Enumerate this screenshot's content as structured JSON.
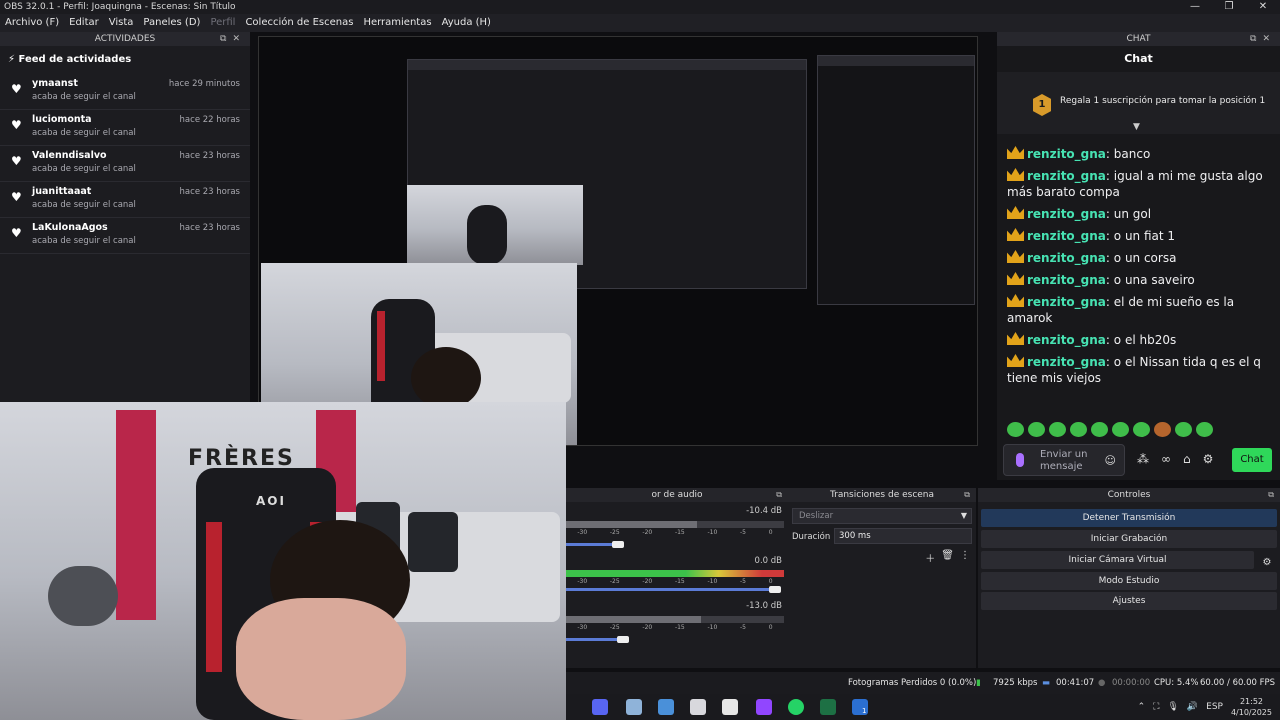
{
  "window": {
    "title": "OBS 32.0.1 - Perfil: Joaquingna - Escenas: Sin Título",
    "controls": [
      "—",
      "❐",
      "✕"
    ]
  },
  "menu": [
    {
      "label": "Archivo (F)",
      "enabled": true
    },
    {
      "label": "Editar",
      "enabled": true
    },
    {
      "label": "Vista",
      "enabled": true
    },
    {
      "label": "Paneles (D)",
      "enabled": true
    },
    {
      "label": "Perfil",
      "enabled": false
    },
    {
      "label": "Colección de Escenas",
      "enabled": true
    },
    {
      "label": "Herramientas",
      "enabled": true
    },
    {
      "label": "Ayuda (H)",
      "enabled": true
    }
  ],
  "activities": {
    "dock_title": "ACTIVIDADES",
    "feed_title": "Feed de actividades",
    "items": [
      {
        "name": "ymaanst",
        "time": "hace 29 minutos",
        "action": "acaba de seguir el canal"
      },
      {
        "name": "luciomonta",
        "time": "hace 22 horas",
        "action": "acaba de seguir el canal"
      },
      {
        "name": "Valenndisalvo",
        "time": "hace 23 horas",
        "action": "acaba de seguir el canal"
      },
      {
        "name": "juanittaaat",
        "time": "hace 23 horas",
        "action": "acaba de seguir el canal"
      },
      {
        "name": "LaKulonaAgos",
        "time": "hace 23 horas",
        "action": "acaba de seguir el canal"
      }
    ]
  },
  "preview": {
    "banner_text": "FRÈRES",
    "chair_text": "AOI"
  },
  "chat": {
    "dock_title": "CHAT",
    "title": "Chat",
    "gift_rank": "1",
    "gift_text": "Regala 1 suscripción para tomar la posición 1",
    "messages": [
      {
        "user": "renzito_gna",
        "text": "banco"
      },
      {
        "user": "renzito_gna",
        "text": "igual a mi me gusta algo más barato compa"
      },
      {
        "user": "renzito_gna",
        "text": "un gol"
      },
      {
        "user": "renzito_gna",
        "text": "o un fiat 1"
      },
      {
        "user": "renzito_gna",
        "text": "o un corsa"
      },
      {
        "user": "renzito_gna",
        "text": "o una saveiro"
      },
      {
        "user": "renzito_gna",
        "text": "el de mi sueño es la amarok"
      },
      {
        "user": "renzito_gna",
        "text": "o el hb20s"
      },
      {
        "user": "renzito_gna",
        "text": "o el Nissan tida q es el q tiene mis viejos"
      }
    ],
    "input_placeholder": "Enviar un mensaje",
    "send_label": "Chat"
  },
  "mixer": {
    "title": "or de audio",
    "channels": [
      {
        "db": "-10.4 dB",
        "level": 0.24
      },
      {
        "db": "0.0 dB",
        "level": 0.96
      },
      {
        "db": "-13.0 dB",
        "level": 0.26
      }
    ],
    "ticks": [
      "-30",
      "-25",
      "-20",
      "-15",
      "-10",
      "-5",
      "0"
    ]
  },
  "transitions": {
    "title": "Transiciones de escena",
    "selected": "Deslizar",
    "duration_label": "Duración",
    "duration_value": "300 ms"
  },
  "controls": {
    "title": "Controles",
    "buttons": [
      "Detener Transmisión",
      "Iniciar Grabación",
      "Iniciar Cámara Virtual",
      "Modo Estudio",
      "Ajustes"
    ]
  },
  "status": {
    "dropped": "Fotogramas Perdidos 0 (0.0%)",
    "bitrate": "7925 kbps",
    "stream_time": "00:41:07",
    "rec_time": "00:00:00",
    "cpu": "CPU: 5.4%",
    "fps": "60.00 / 60.00 FPS"
  },
  "taskbar": {
    "lang": "ESP",
    "time": "21:52",
    "date": "4/10/2025",
    "badge": "1"
  },
  "colors": {
    "accent_green": "#2fd85a",
    "chat_user": "#47e3b3",
    "crown": "#e2a31a",
    "live_button": "#22395a"
  }
}
